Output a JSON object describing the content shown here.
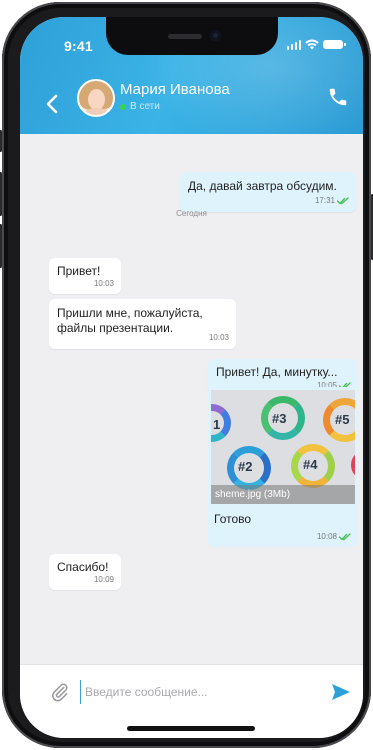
{
  "status_bar": {
    "time": "9:41"
  },
  "header": {
    "contact_name": "Мария Иванова",
    "contact_status": "В сети",
    "accent_color": "#2ea0d8",
    "online_color": "#35d64f"
  },
  "messages": [
    {
      "direction": "out",
      "text": "Да, давай завтра обсудим.",
      "time": "17:31",
      "read": true
    },
    {
      "direction": "separator",
      "text": "Сегодня"
    },
    {
      "direction": "in",
      "text": "Привет!",
      "time": "10:03"
    },
    {
      "direction": "in",
      "text": "Пришли мне, пожалуйста, файлы презентации.",
      "time": "10:03"
    },
    {
      "direction": "out",
      "text": "Привет! Да, минутку...",
      "time": "10:05",
      "read": true
    },
    {
      "direction": "out",
      "kind": "image",
      "file_caption": "sheme.jpg (3Mb)",
      "text": "Готово",
      "time": "10:08",
      "read": true,
      "image_labels": [
        "1",
        "#3",
        "#5",
        "#2",
        "#4"
      ]
    },
    {
      "direction": "in",
      "text": "Спасибо!",
      "time": "10:09"
    }
  ],
  "composer": {
    "placeholder": "Введите сообщение...",
    "value": ""
  },
  "icons": {
    "back": "chevron-left-icon",
    "call": "phone-icon",
    "attach": "paperclip-icon",
    "send": "send-icon",
    "read_receipt": "double-check-icon"
  }
}
